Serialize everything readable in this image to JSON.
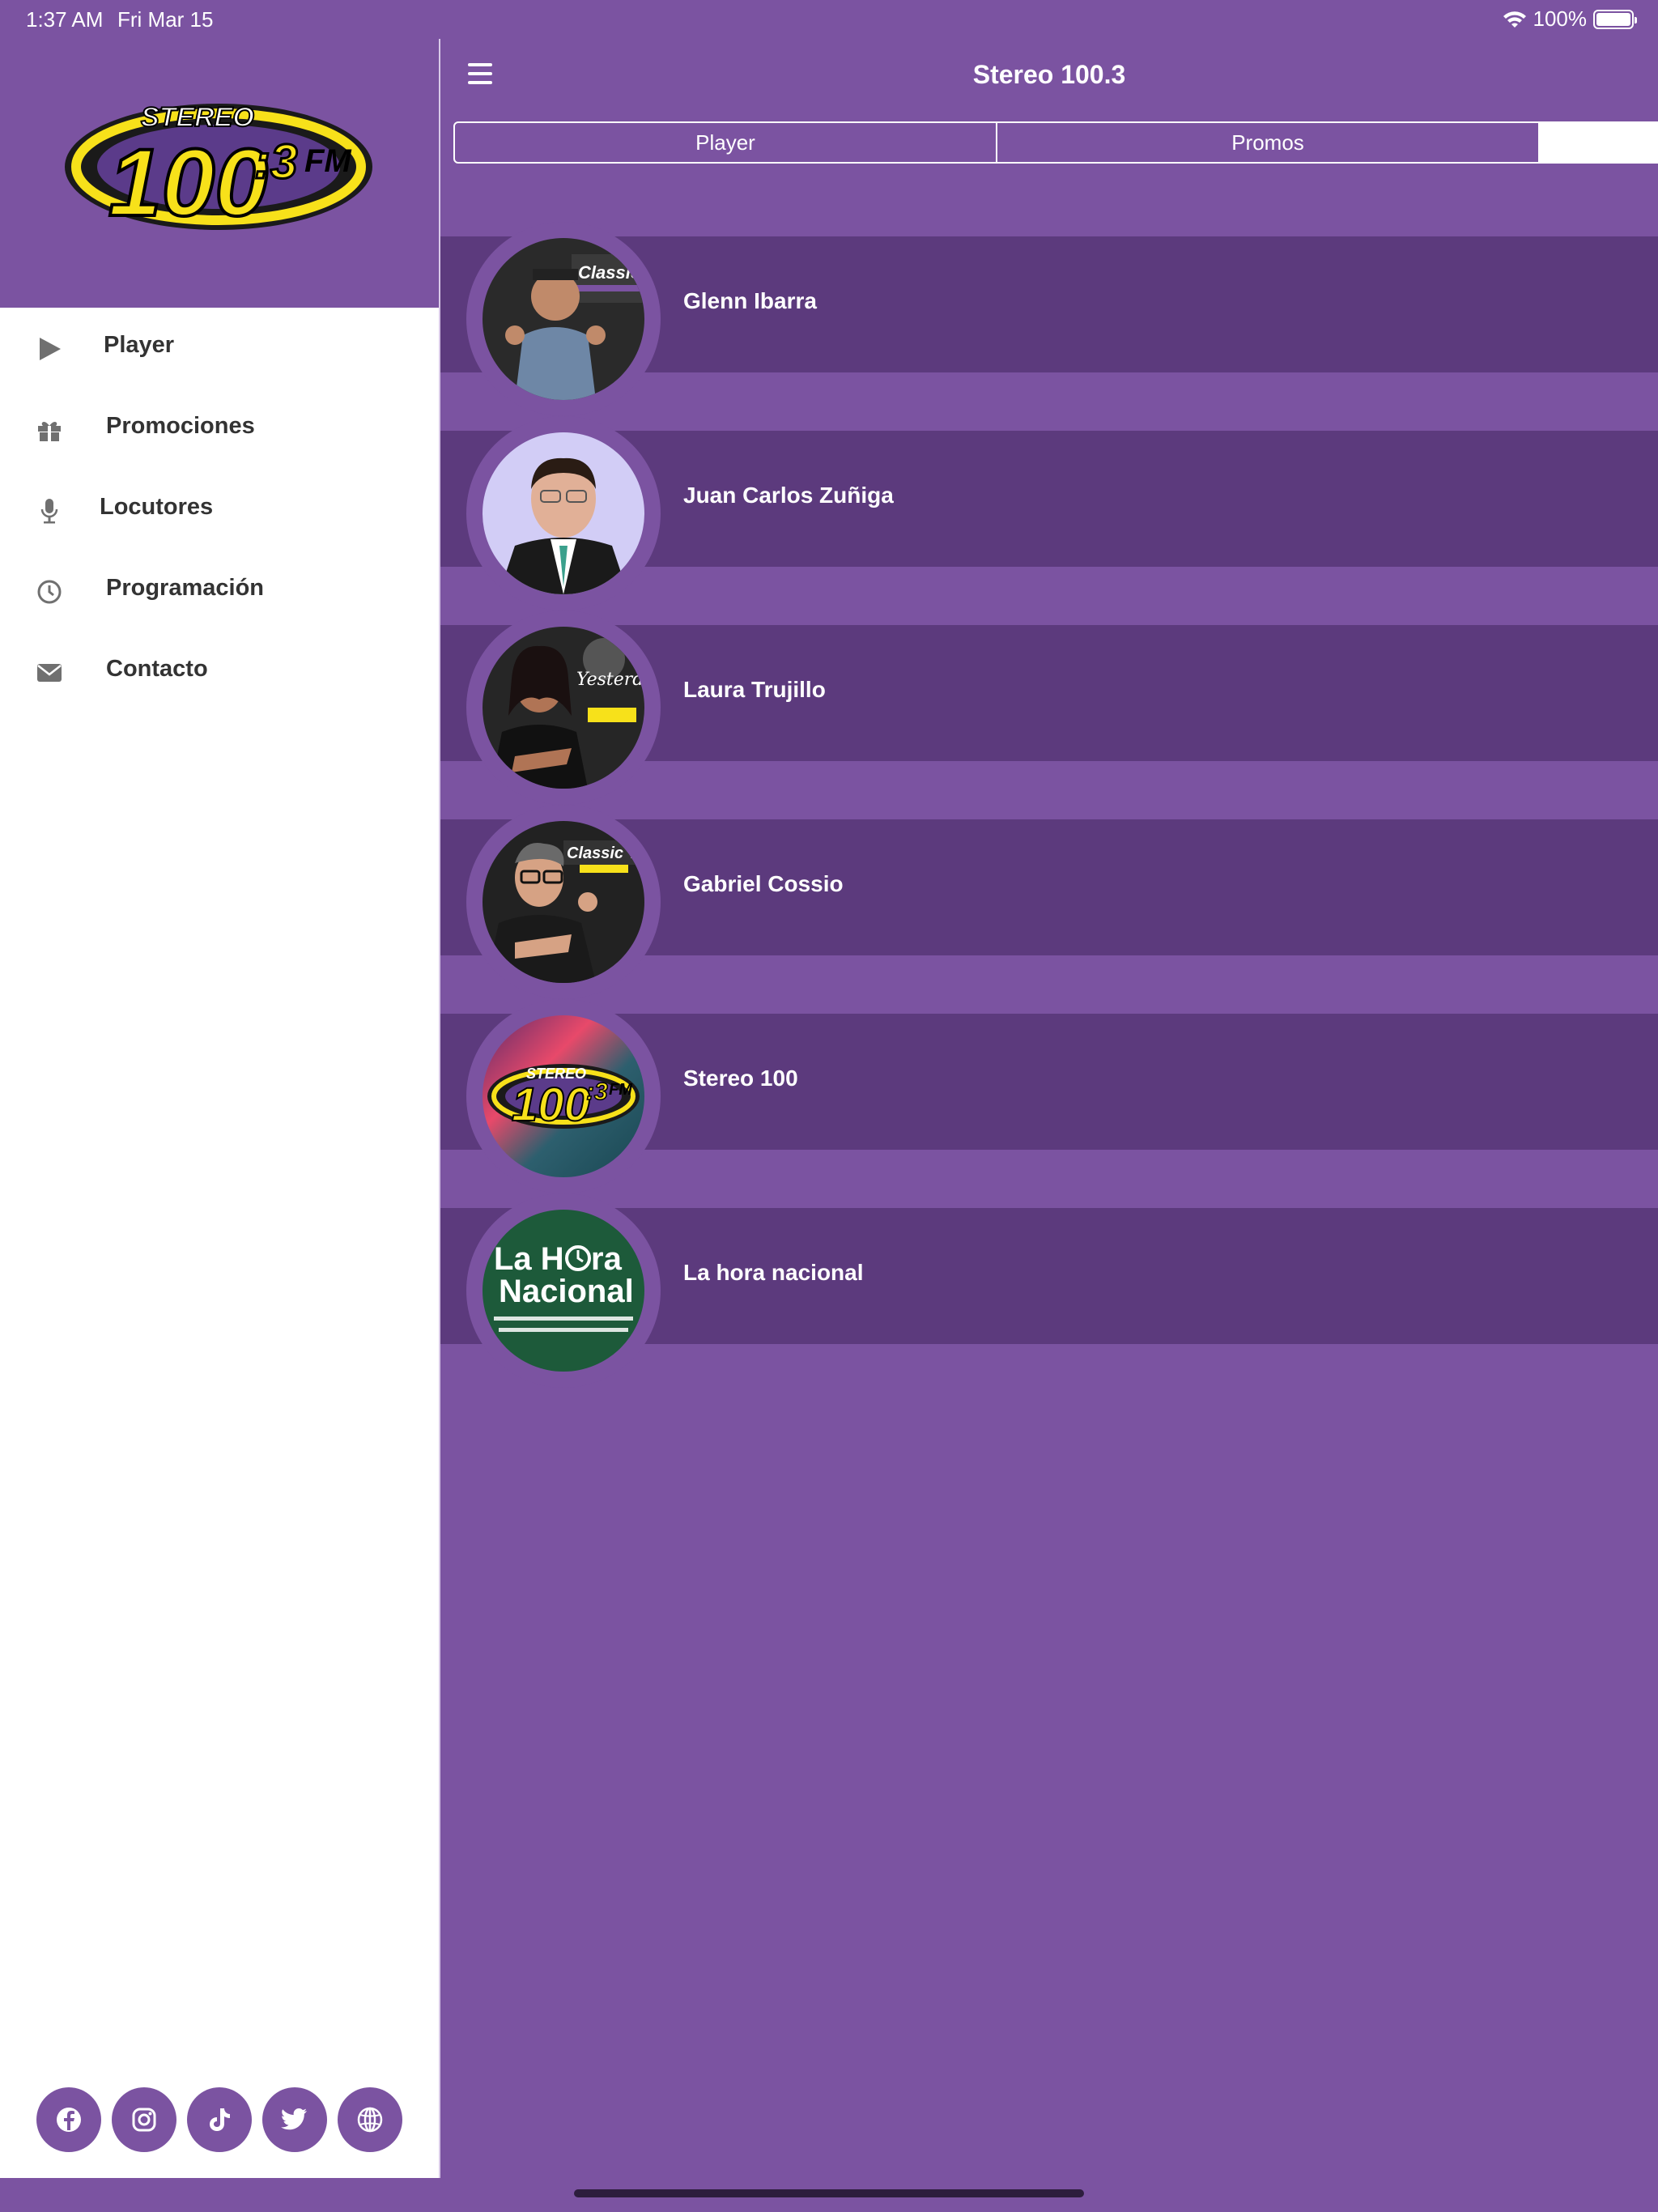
{
  "status_bar": {
    "time": "1:37 AM",
    "date": "Fri Mar 15",
    "battery": "100%"
  },
  "header": {
    "title": "Stereo 100.3"
  },
  "tabs": [
    {
      "label": "Player"
    },
    {
      "label": "Promos"
    },
    {
      "label": ""
    }
  ],
  "drawer": {
    "logo": {
      "line1": "STEREO",
      "line2": "100",
      "line3": ":3",
      "line4": "FM"
    },
    "items": [
      {
        "label": "Player",
        "icon": "play-icon"
      },
      {
        "label": "Promociones",
        "icon": "gift-icon"
      },
      {
        "label": "Locutores",
        "icon": "microphone-icon"
      },
      {
        "label": "Programación",
        "icon": "clock-icon"
      },
      {
        "label": "Contacto",
        "icon": "envelope-icon"
      }
    ],
    "social": [
      "facebook-icon",
      "instagram-icon",
      "tiktok-icon",
      "twitter-icon",
      "globe-icon"
    ]
  },
  "hosts": [
    {
      "name": "Glenn Ibarra"
    },
    {
      "name": "Juan Carlos Zuñiga"
    },
    {
      "name": "Laura Trujillo"
    },
    {
      "name": "Gabriel Cossio"
    },
    {
      "name": "Stereo 100"
    },
    {
      "name": "La hora nacional"
    }
  ],
  "colors": {
    "primary": "#7b53a1",
    "row": "#5c3a7d",
    "logo_yellow": "#f7e11a"
  }
}
